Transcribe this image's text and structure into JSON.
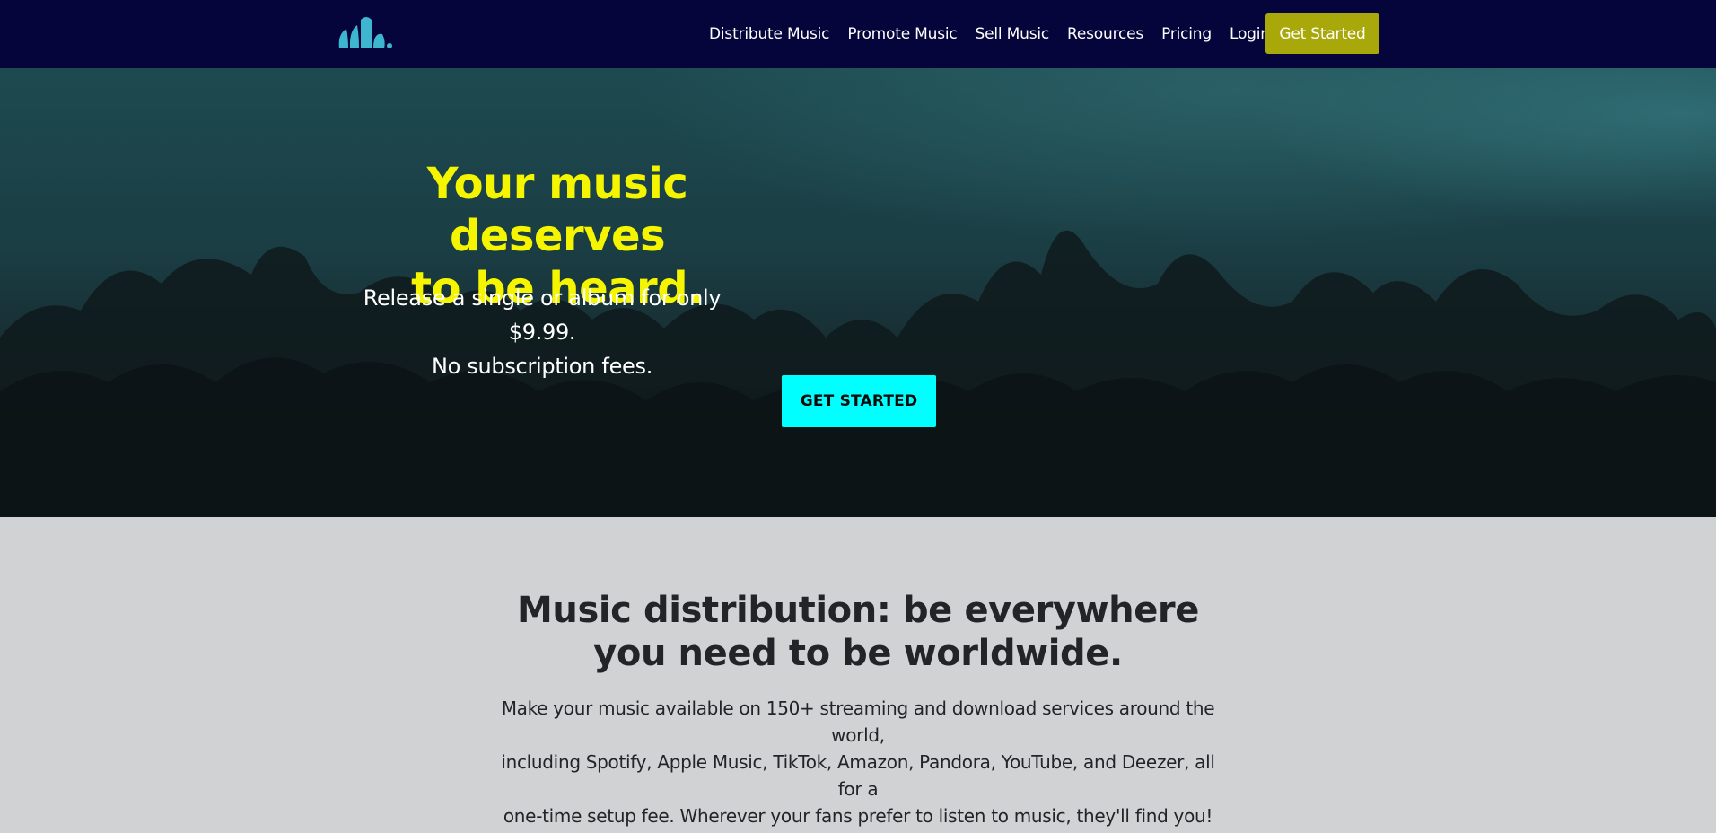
{
  "nav": {
    "logo_name": "logo-icon",
    "links": [
      "Distribute Music",
      "Promote Music",
      "Sell Music",
      "Resources",
      "Pricing",
      "Login"
    ],
    "cta_label": "Get Started"
  },
  "hero": {
    "title_line1": "Your music deserves",
    "title_line2": "to be heard.",
    "sub_line1": "Release a single or album for only $9.99.",
    "sub_line2": "No subscription fees.",
    "cta_label": "GET STARTED"
  },
  "section": {
    "title_line1": "Music distribution: be everywhere",
    "title_line2": "you need to be worldwide.",
    "body_line1": "Make your music available on 150+ streaming and download services around the world,",
    "body_line2": "including Spotify, Apple Music, TikTok, Amazon, Pandora, YouTube, and Deezer, all for a",
    "body_line3": "one-time setup fee. Wherever your fans prefer to listen to music, they'll find you!"
  },
  "colors": {
    "nav_bg": "#05053c",
    "nav_cta_bg": "#a8a80a",
    "hero_title": "#f5f500",
    "hero_cta_bg": "#00ffff",
    "section_bg": "#d1d2d4",
    "logo": "#3fb6cf"
  }
}
